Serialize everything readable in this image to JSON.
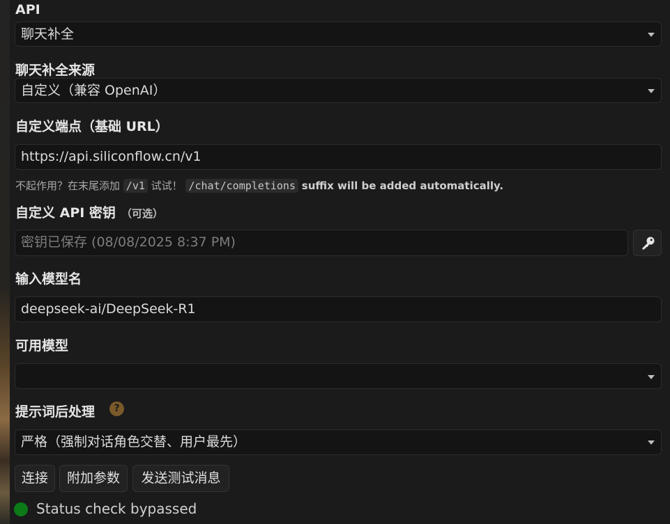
{
  "api": {
    "label": "API",
    "value": "聊天补全"
  },
  "source": {
    "label": "聊天补全来源",
    "value": "自定义（兼容 OpenAI）"
  },
  "endpoint": {
    "label": "自定义端点（基础 URL）",
    "value": "https://api.siliconflow.cn/v1",
    "hint_prefix": "不起作用？在末尾添加",
    "hint_code1": "/v1",
    "hint_mid": "试试！",
    "hint_code2": "/chat/completions",
    "hint_suffix": "suffix will be added automatically."
  },
  "api_key": {
    "label": "自定义 API 密钥",
    "optional": "（可选）",
    "placeholder": "密钥已保存 (08/08/2025 8:37 PM)",
    "key_icon": "key-icon"
  },
  "model_input": {
    "label": "输入模型名",
    "value": "deepseek-ai/DeepSeek-R1"
  },
  "available_models": {
    "label": "可用模型",
    "value": ""
  },
  "prompt_processing": {
    "label": "提示词后处理",
    "help": "?",
    "value": "严格（强制对话角色交替、用户最先）"
  },
  "buttons": {
    "connect": "连接",
    "extra_params": "附加参数",
    "send_test": "发送测试消息"
  },
  "status": {
    "text": "Status check bypassed",
    "color": "#0b7a17"
  }
}
